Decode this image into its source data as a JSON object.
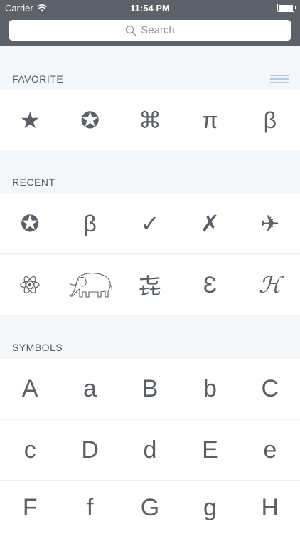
{
  "status_bar": {
    "carrier": "Carrier",
    "time": "11:54 PM"
  },
  "search": {
    "placeholder": "Search"
  },
  "sections": {
    "favorite": {
      "title": "FAVORITE",
      "items": [
        "★",
        "✪",
        "⌘",
        "π",
        "β"
      ]
    },
    "recent": {
      "title": "RECENT",
      "row1": [
        "✪",
        "β",
        "✓",
        "✗",
        "✈"
      ],
      "row2_icons": [
        "atom-icon",
        "elephant-icon"
      ],
      "row2_text": [
        "㐂",
        "Ɛ",
        "ℋ"
      ]
    },
    "symbols": {
      "title": "SYMBOLS",
      "row1": [
        "A",
        "a",
        "B",
        "b",
        "C"
      ],
      "row2": [
        "c",
        "D",
        "d",
        "E",
        "e"
      ],
      "row3": [
        "F",
        "f",
        "G",
        "g",
        "H"
      ]
    }
  },
  "colors": {
    "bar_background": "#5d6169",
    "symbol": "#5b5f66",
    "reorder_accent": "#8ab0d6"
  }
}
